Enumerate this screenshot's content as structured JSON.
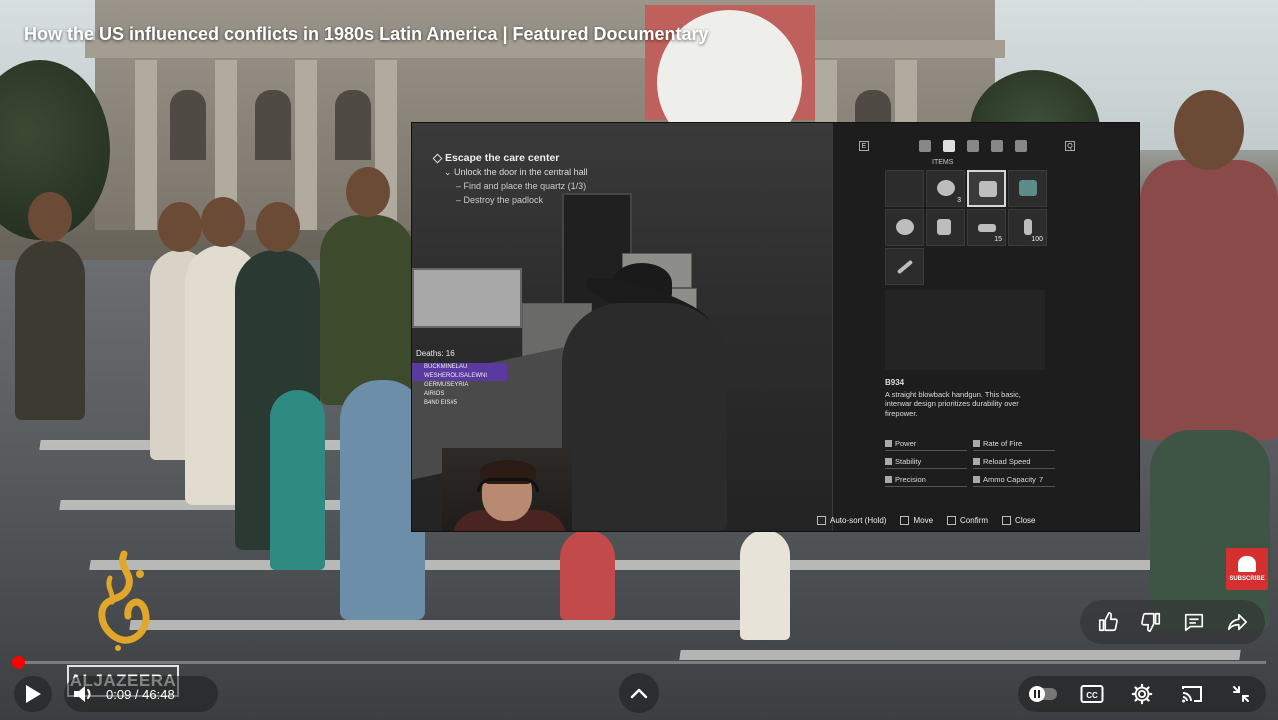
{
  "video": {
    "title": "How the US influenced conflicts in 1980s Latin America | Featured Documentary"
  },
  "game_overlay": {
    "objective": {
      "main": "Escape the care center",
      "sub": "Unlock the door in the central hall",
      "steps": [
        "Find and place the quartz (1/3)",
        "Destroy the padlock"
      ]
    },
    "deaths": "Deaths: 16",
    "chat_rows": [
      "BUCKMINELAU",
      "WESHEROLISALEWNI",
      "GERMUSEYRIA",
      "AIRIOS",
      "B4N0 EIS#5"
    ],
    "inventory": {
      "tab_label": "ITEMS",
      "counts": [
        "3",
        "15",
        "100"
      ],
      "item_name": "B934",
      "item_description": "A straight blowback handgun. This basic, interwar design prioritizes durability over firepower.",
      "stats": [
        "Power",
        "Rate of Fire",
        "Stability",
        "Reload Speed",
        "Precision",
        "Ammo Capacity"
      ],
      "ammo_capacity_value": "7",
      "bottom_hints": [
        "Auto-sort (Hold)",
        "Move",
        "Confirm",
        "Close"
      ]
    }
  },
  "brand": {
    "logo_word": "ALJAZEERA",
    "subscribe_label": "SUBSCRIBE"
  },
  "actions": {
    "icons": [
      "thumbs-up-icon",
      "thumbs-down-icon",
      "comment-icon",
      "share-icon"
    ]
  },
  "player": {
    "current_time": "0:09",
    "duration": "46:48",
    "time_display": "0:09 / 46:48",
    "progress_fraction": 0.0032,
    "accent_color": "#ff0000",
    "right_controls": [
      "autoplay-toggle",
      "captions-icon",
      "settings-icon",
      "cast-icon",
      "exit-fullscreen-icon"
    ]
  }
}
